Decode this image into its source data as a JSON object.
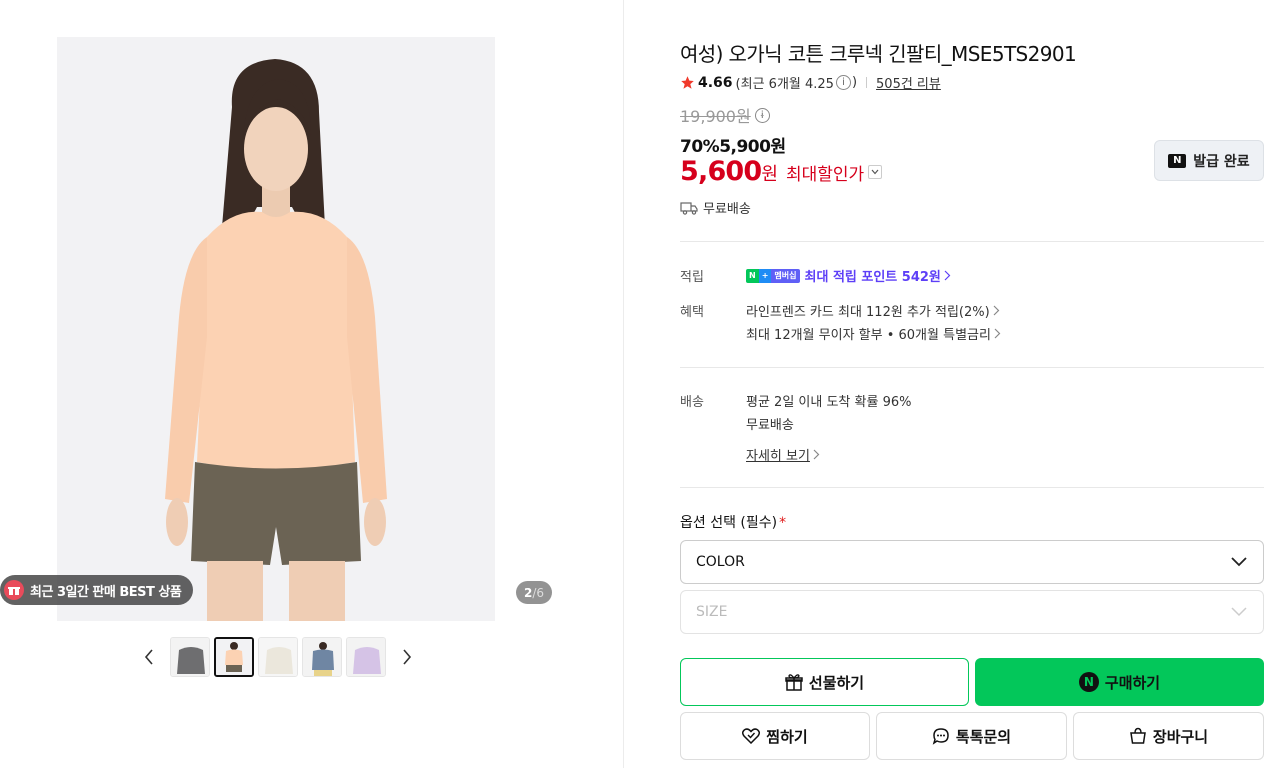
{
  "gallery": {
    "best_badge": "최근 3일간 판매 BEST 상품",
    "counter_current": "2",
    "counter_total": "/6",
    "thumbnails": [
      "gray",
      "peach",
      "ivory",
      "denim",
      "lavender"
    ],
    "active_thumbnail": 1
  },
  "product": {
    "title": "여성) 오가닉 코튼 크루넥 긴팔티_MSE5TS2901",
    "rating": "4.66",
    "rating_recent": "(최근 6개월 4.25",
    "rating_close": ")",
    "reviews": "505건 리뷰",
    "original_price": "19,900원",
    "discount_line": "70%5,900원",
    "max_price": "5,600",
    "max_price_unit": "원",
    "max_price_label": "최대할인가",
    "coupon_button": "발급 완료",
    "free_shipping": "무료배송"
  },
  "benefits": {
    "points_label": "적립",
    "points_badge_n": "N",
    "points_badge_plus": "+",
    "points_badge_member": "멤버십",
    "points_text": "최대 적립 포인트 542원",
    "benefit_label": "혜택",
    "benefit_line1": "라인프렌즈 카드 최대 112원 추가 적립(2%)",
    "benefit_line2": "최대 12개월 무이자 할부 • 60개월 특별금리"
  },
  "delivery": {
    "label": "배송",
    "line1": "평균 2일 이내 도착 확률 96%",
    "line2": "무료배송",
    "details_link": "자세히 보기"
  },
  "options": {
    "title": "옵션 선택 (필수)",
    "required_mark": "*",
    "color_select": "COLOR",
    "size_select": "SIZE"
  },
  "actions": {
    "gift": "선물하기",
    "buy": "구매하기",
    "wish": "찜하기",
    "talk": "톡톡문의",
    "cart": "장바구니"
  },
  "colors": {
    "naver_green": "#03c75a",
    "sale_red": "#d6001c",
    "point_purple": "#5d3ff7"
  }
}
